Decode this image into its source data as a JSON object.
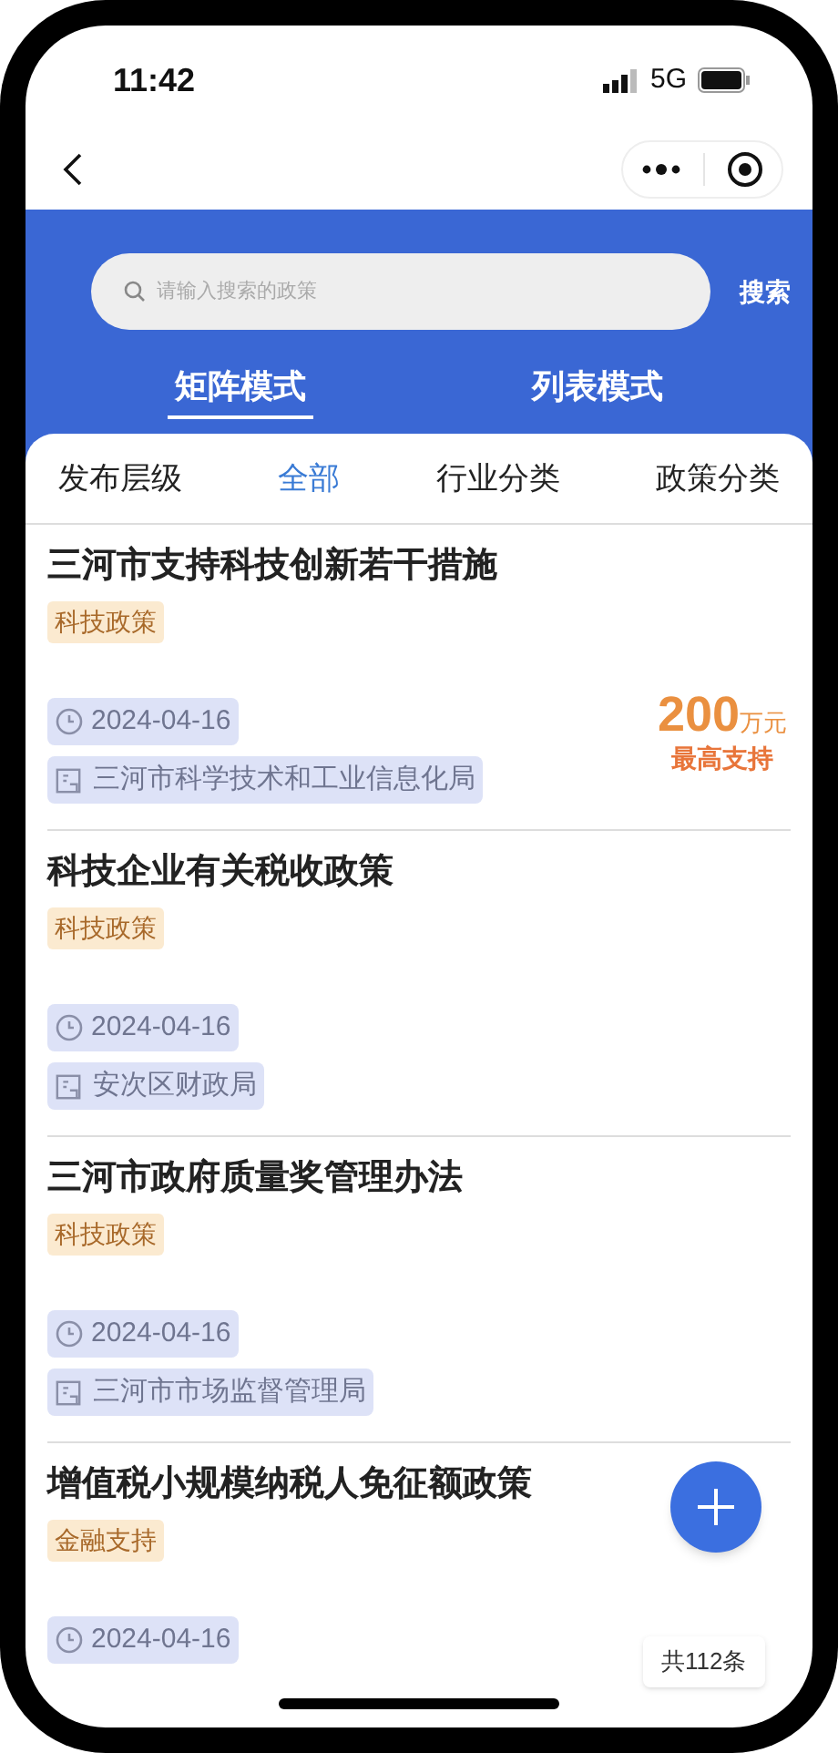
{
  "status_bar": {
    "time": "11:42",
    "network": "5G"
  },
  "search": {
    "placeholder": "请输入搜索的政策",
    "button": "搜索"
  },
  "view_tabs": [
    {
      "label": "矩阵模式",
      "selected": true
    },
    {
      "label": "列表模式",
      "selected": false
    }
  ],
  "filters": [
    {
      "label": "发布层级",
      "selected": false
    },
    {
      "label": "全部",
      "selected": true
    },
    {
      "label": "行业分类",
      "selected": false
    },
    {
      "label": "政策分类",
      "selected": false
    }
  ],
  "policies": [
    {
      "title": "三河市支持科技创新若干措施",
      "tag": "科技政策",
      "date": "2024-04-16",
      "department": "三河市科学技术和工业信息化局",
      "amount": "200",
      "amount_unit": "万元",
      "amount_label": "最高支持"
    },
    {
      "title": "科技企业有关税收政策",
      "tag": "科技政策",
      "date": "2024-04-16",
      "department": "安次区财政局"
    },
    {
      "title": "三河市政府质量奖管理办法",
      "tag": "科技政策",
      "date": "2024-04-16",
      "department": "三河市市场监督管理局"
    },
    {
      "title": "增值税小规模纳税人免征额政策",
      "tag": "金融支持",
      "date": "2024-04-16"
    }
  ],
  "total_count": "共112条"
}
